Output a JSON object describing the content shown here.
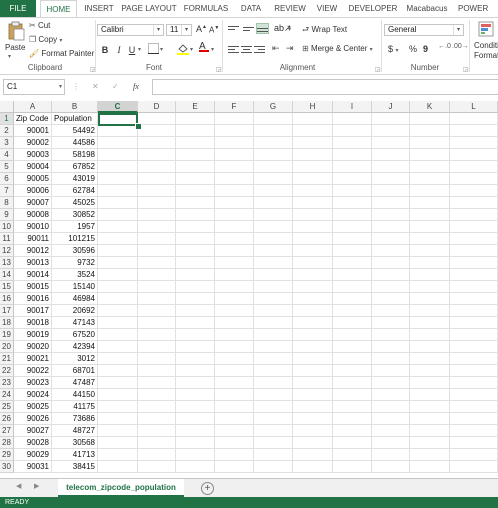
{
  "tabs": {
    "file": "FILE",
    "home": "HOME",
    "insert": "INSERT",
    "page_layout": "PAGE LAYOUT",
    "formulas": "FORMULAS",
    "data": "DATA",
    "review": "REVIEW",
    "view": "VIEW",
    "developer": "DEVELOPER",
    "macabacus": "Macabacus",
    "power": "POWER QU"
  },
  "clipboard": {
    "paste": "Paste",
    "cut": "Cut",
    "copy": "Copy",
    "format_painter": "Format Painter",
    "label": "Clipboard"
  },
  "font": {
    "name": "Calibri",
    "size": "11",
    "bold": "B",
    "italic": "I",
    "underline": "U",
    "grow": "A",
    "shrink": "A",
    "font_color": "A",
    "label": "Font"
  },
  "alignment": {
    "wrap_text": "Wrap Text",
    "merge_center": "Merge & Center",
    "label": "Alignment"
  },
  "number": {
    "format": "General",
    "currency": "$",
    "percent": "%",
    "comma": "9",
    "label": "Number"
  },
  "styles": {
    "conditional_1": "Conditi",
    "conditional_2": "Formatti"
  },
  "formula_bar": {
    "name_box": "C1",
    "cancel": "✕",
    "enter": "✓",
    "fx": "fx",
    "value": ""
  },
  "columns": [
    "A",
    "B",
    "C",
    "D",
    "E",
    "F",
    "G",
    "H",
    "I",
    "J",
    "K",
    "L"
  ],
  "selected_column": "C",
  "headers": {
    "a": "Zip Code",
    "b": "Population"
  },
  "rows": [
    [
      "90001",
      "54492"
    ],
    [
      "90002",
      "44586"
    ],
    [
      "90003",
      "58198"
    ],
    [
      "90004",
      "67852"
    ],
    [
      "90005",
      "43019"
    ],
    [
      "90006",
      "62784"
    ],
    [
      "90007",
      "45025"
    ],
    [
      "90008",
      "30852"
    ],
    [
      "90010",
      "1957"
    ],
    [
      "90011",
      "101215"
    ],
    [
      "90012",
      "30596"
    ],
    [
      "90013",
      "9732"
    ],
    [
      "90014",
      "3524"
    ],
    [
      "90015",
      "15140"
    ],
    [
      "90016",
      "46984"
    ],
    [
      "90017",
      "20692"
    ],
    [
      "90018",
      "47143"
    ],
    [
      "90019",
      "67520"
    ],
    [
      "90020",
      "42394"
    ],
    [
      "90021",
      "3012"
    ],
    [
      "90022",
      "68701"
    ],
    [
      "90023",
      "47487"
    ],
    [
      "90024",
      "44150"
    ],
    [
      "90025",
      "41175"
    ],
    [
      "90026",
      "73686"
    ],
    [
      "90027",
      "48727"
    ],
    [
      "90028",
      "30568"
    ],
    [
      "90029",
      "41713"
    ],
    [
      "90031",
      "38415"
    ]
  ],
  "sheet": {
    "name": "telecom_zipcode_population",
    "add": "+"
  },
  "status": "READY",
  "colors": {
    "accent": "#217346"
  }
}
